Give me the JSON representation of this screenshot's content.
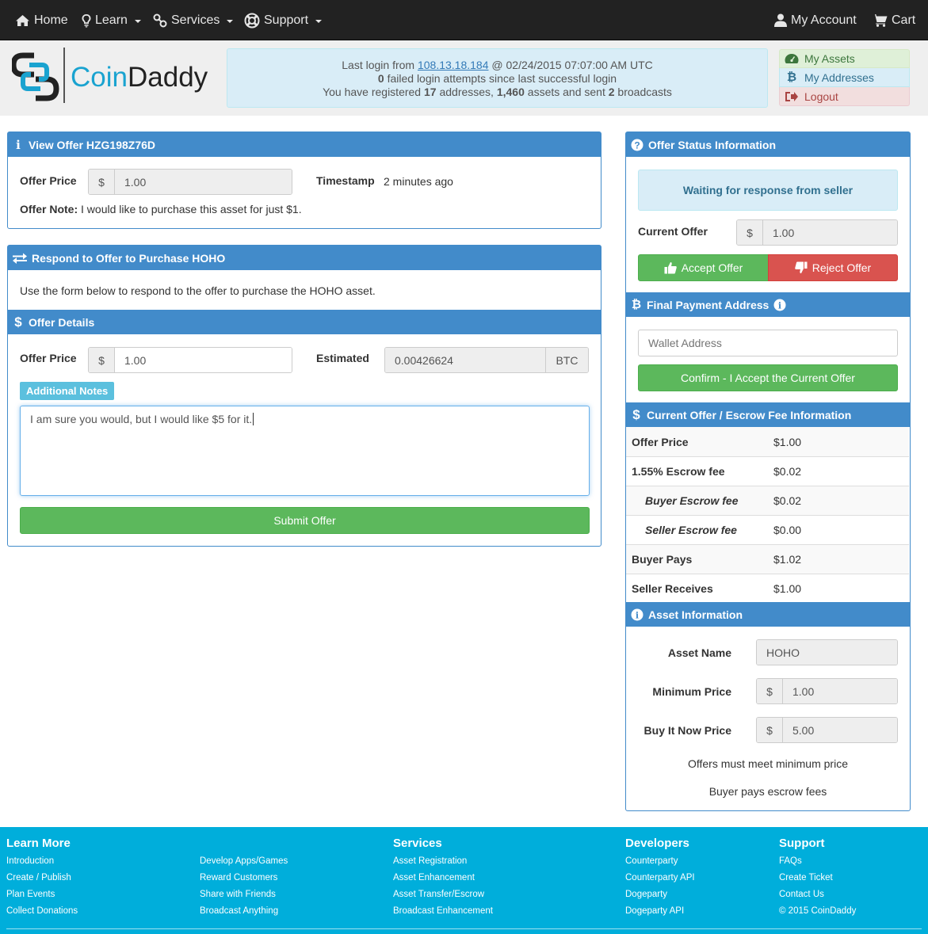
{
  "nav": {
    "home": "Home",
    "learn": "Learn",
    "services": "Services",
    "support": "Support",
    "my_account": "My Account",
    "cart": "Cart"
  },
  "brand": {
    "name_part1": "Coin",
    "name_part2": "Daddy"
  },
  "login_info": {
    "prefix": "Last login from ",
    "ip": "108.13.18.184",
    "when": " @ 02/24/2015 07:07:00 AM UTC",
    "failed_count": "0",
    "failed_text": " failed login attempts since last successful login",
    "reg_prefix": "You have registered ",
    "addresses": "17",
    "addr_text": " addresses, ",
    "assets": "1,460",
    "assets_text": " assets and sent ",
    "broadcasts": "2",
    "broadcasts_text": " broadcasts"
  },
  "account_menu": {
    "my_assets": "My Assets",
    "my_addresses": "My Addresses",
    "logout": "Logout"
  },
  "view_offer": {
    "title": "View Offer HZG198Z76D",
    "price_label": "Offer Price",
    "currency": "$",
    "price": "1.00",
    "timestamp_label": "Timestamp",
    "timestamp": "2 minutes ago",
    "note_label": "Offer Note:",
    "note": " I would like to purchase this asset for just $1."
  },
  "respond": {
    "title": "Respond to Offer to Purchase HOHO",
    "intro": "Use the form below to respond to the offer to purchase the HOHO asset.",
    "details_title": "Offer Details",
    "price_label": "Offer Price",
    "currency": "$",
    "price": "1.00",
    "estimated_label": "Estimated",
    "estimated": "0.00426624",
    "estimated_unit": "BTC",
    "notes_label": "Additional Notes",
    "notes": "I am sure you would, but I would like $5 for it.",
    "submit": "Submit Offer"
  },
  "status": {
    "title": "Offer Status Information",
    "message": "Waiting for response from seller",
    "current_label": "Current Offer",
    "currency": "$",
    "current": "1.00",
    "accept": "Accept Offer",
    "reject": "Reject Offer"
  },
  "payment": {
    "title": "Final Payment Address",
    "placeholder": "Wallet Address",
    "confirm": "Confirm - I Accept the Current Offer"
  },
  "fees": {
    "title": "Current Offer / Escrow Fee Information",
    "rows": [
      {
        "label": "Offer Price",
        "value": "$1.00"
      },
      {
        "label": "1.55% Escrow fee",
        "value": "$0.02"
      },
      {
        "label": "Buyer Escrow fee",
        "value": "$0.02"
      },
      {
        "label": "Seller Escrow fee",
        "value": "$0.00"
      },
      {
        "label": "Buyer Pays",
        "value": "$1.02"
      },
      {
        "label": "Seller Receives",
        "value": "$1.00"
      }
    ]
  },
  "asset": {
    "title": "Asset Information",
    "name_label": "Asset Name",
    "name": "HOHO",
    "min_label": "Minimum Price",
    "currency": "$",
    "min": "1.00",
    "bin_label": "Buy It Now Price",
    "bin": "5.00",
    "note1": "Offers must meet minimum price",
    "note2": "Buyer pays escrow fees"
  },
  "footer": {
    "learn_more": {
      "title": "Learn More",
      "col1": [
        "Introduction",
        "Create / Publish",
        "Plan Events",
        "Collect Donations"
      ],
      "col2": [
        "Develop Apps/Games",
        "Reward Customers",
        "Share with Friends",
        "Broadcast Anything"
      ]
    },
    "services": {
      "title": "Services",
      "items": [
        "Asset Registration",
        "Asset Enhancement",
        "Asset Transfer/Escrow",
        "Broadcast Enhancement"
      ]
    },
    "developers": {
      "title": "Developers",
      "items": [
        "Counterparty",
        "Counterparty API",
        "Dogeparty",
        "Dogeparty API"
      ]
    },
    "support": {
      "title": "Support",
      "items": [
        "FAQs",
        "Create Ticket",
        "Contact Us",
        "© 2015 CoinDaddy"
      ]
    }
  },
  "colors": {
    "primary": "#428bca",
    "success": "#5cb85c",
    "danger": "#d9534f",
    "footer": "#00aedb",
    "info_bg": "#d9edf7"
  }
}
